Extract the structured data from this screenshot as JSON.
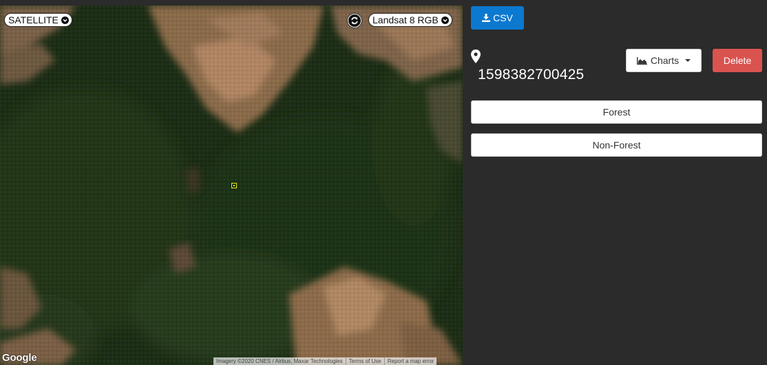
{
  "map": {
    "map_type_selected": "SATELLITE",
    "layer_selected": "Landsat 8 RGB",
    "logo_text": "Google",
    "attribution": [
      "Imagery ©2020 CNES / Airbus, Maxar Technologies",
      "Terms of Use",
      "Report a map error"
    ],
    "marker_color": "#e7e51f"
  },
  "panel": {
    "csv_label": "CSV",
    "point_id": "1598382700425",
    "charts_label": "Charts",
    "delete_label": "Delete",
    "class_buttons": [
      "Forest",
      "Non-Forest"
    ]
  },
  "colors": {
    "background": "#2b2b2b",
    "primary": "#0b79d0",
    "danger": "#d9534f"
  },
  "icons": {
    "csv": "download-icon",
    "point": "map-marker-icon",
    "charts": "area-chart-icon",
    "refresh": "refresh-icon"
  }
}
